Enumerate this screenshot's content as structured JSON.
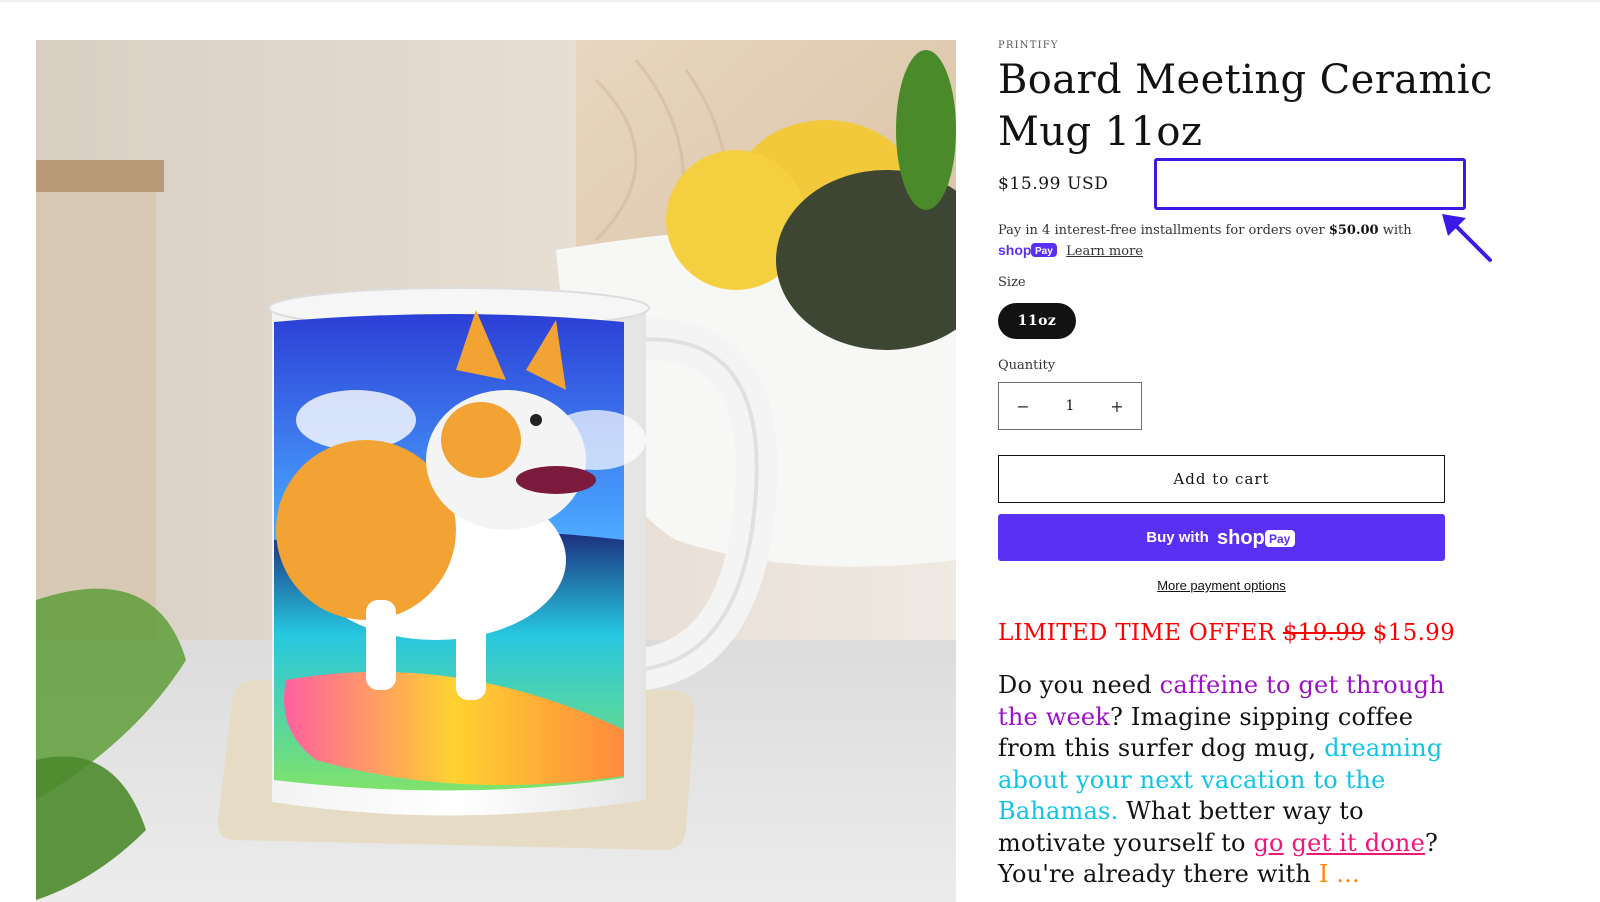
{
  "product": {
    "vendor": "PRINTIFY",
    "title": "Board Meeting Ceramic Mug 11oz",
    "price": "$15.99 USD",
    "installments_text": "Pay in 4 interest-free installments for orders over",
    "installments_amount": "$50.00",
    "installments_with": "with",
    "shoppay_brand": "shop",
    "shoppay_badge": "Pay",
    "learn_more": "Learn more",
    "size_label": "Size",
    "size_selected": "11oz",
    "quantity_label": "Quantity",
    "quantity_value": "1",
    "decrement_symbol": "−",
    "increment_symbol": "+",
    "add_to_cart": "Add to cart",
    "buy_with": "Buy with",
    "more_payment_options": "More payment options"
  },
  "offer": {
    "label": "LIMITED TIME OFFER",
    "old_price": "$19.99",
    "new_price": "$15.99"
  },
  "description": {
    "p1": "Do you need ",
    "p2": "caffeine to get through the week",
    "p3": "? Imagine sipping coffee from this surfer dog mug, ",
    "p4": "dreaming about your next vacation to the Bahamas.",
    "p5": " What better way to motivate yourself to ",
    "p6": "go",
    "p7": " ",
    "p8": "get it done",
    "p9": "? You're already there with",
    "p10": " I ..."
  },
  "colors": {
    "highlight_box": "#3b1ae8",
    "shoppay_purple": "#5a31f4",
    "offer_red": "#ff0000",
    "desc_purple": "#9a10c8",
    "desc_cyan": "#10c4e6",
    "desc_pink": "#f0157a"
  }
}
